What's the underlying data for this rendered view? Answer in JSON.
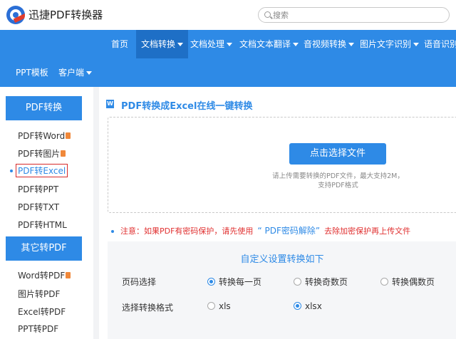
{
  "header": {
    "brand": "迅捷PDF转换器",
    "search_placeholder": "搜索"
  },
  "nav": {
    "row1": [
      {
        "label": "首页",
        "caret": false
      },
      {
        "label": "文档转换",
        "caret": true,
        "active": true
      },
      {
        "label": "文档处理",
        "caret": true
      },
      {
        "label": "文档文本翻译",
        "caret": true
      },
      {
        "label": "音视频转换",
        "caret": true
      },
      {
        "label": "图片文字识别",
        "caret": true
      },
      {
        "label": "语音识别",
        "caret": false
      }
    ],
    "row2": [
      {
        "label": "PPT模板",
        "caret": false
      },
      {
        "label": "客户端",
        "caret": true
      }
    ]
  },
  "sidebar": {
    "group1_title": "PDF转换",
    "group1_items": [
      {
        "label": "PDF转Word",
        "badge": true
      },
      {
        "label": "PDF转图片",
        "badge": true
      },
      {
        "label": "PDF转Excel",
        "badge": false,
        "active": true
      },
      {
        "label": "PDF转PPT",
        "badge": false
      },
      {
        "label": "PDF转TXT",
        "badge": false
      },
      {
        "label": "PDF转HTML",
        "badge": false
      }
    ],
    "group2_title": "其它转PDF",
    "group2_items": [
      {
        "label": "Word转PDF",
        "badge": true
      },
      {
        "label": "图片转PDF",
        "badge": false
      },
      {
        "label": "Excel转PDF",
        "badge": false
      },
      {
        "label": "PPT转PDF",
        "badge": false
      }
    ]
  },
  "main": {
    "title_icon": "W",
    "title": "PDF转换成Excel在线一键转换",
    "upload_button": "点击选择文件",
    "upload_hint_line1": "请上传需要转换的PDF文件，最大支持2M，",
    "upload_hint_line2": "支持PDF格式",
    "notice_prefix": "注意：如果PDF有密码保护，请先使用",
    "notice_link": "“ PDF密码解除”",
    "notice_suffix": "去除加密保护再上传文件",
    "settings_title": "自定义设置转换如下",
    "page_label": "页码选择",
    "page_options": [
      {
        "label": "转换每一页",
        "selected": true
      },
      {
        "label": "转换奇数页",
        "selected": false
      },
      {
        "label": "转换偶数页",
        "selected": false
      }
    ],
    "format_label": "选择转换格式",
    "format_options": [
      {
        "label": "xls",
        "selected": false
      },
      {
        "label": "xlsx",
        "selected": true
      }
    ]
  },
  "colors": {
    "accent": "#2e8ae6",
    "nav_active": "#1e6fc6",
    "warning": "#e03030",
    "badge": "#f0883a"
  }
}
